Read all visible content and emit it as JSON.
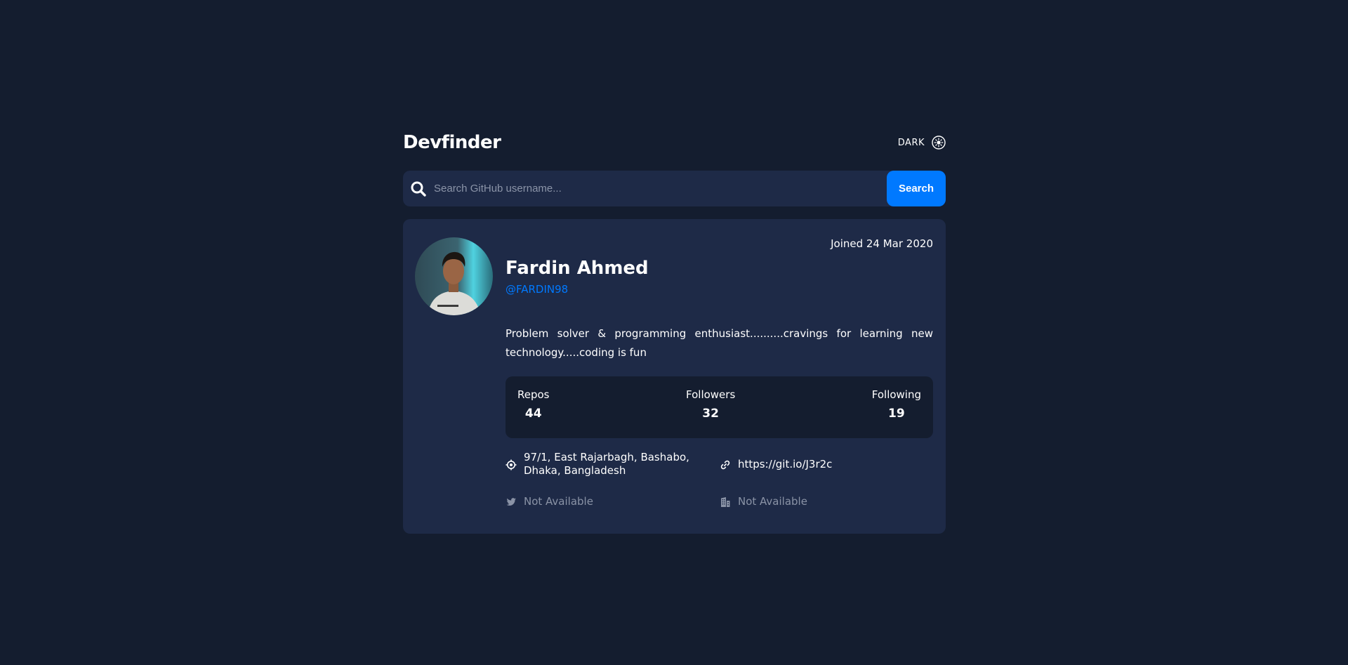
{
  "header": {
    "logo": "Devfinder",
    "theme_label": "DARK",
    "theme_icon": "sun-icon"
  },
  "search": {
    "placeholder": "Search GitHub username...",
    "value": "",
    "button_label": "Search",
    "icon": "search-icon"
  },
  "profile": {
    "joined": "Joined 24 Mar 2020",
    "name": "Fardin Ahmed",
    "login": "@FARDIN98",
    "bio": "Problem solver & programming enthusiast..........cravings for learning new technology.....coding is fun",
    "stats": {
      "repos_label": "Repos",
      "repos_value": "44",
      "followers_label": "Followers",
      "followers_value": "32",
      "following_label": "Following",
      "following_value": "19"
    },
    "location": "97/1, East Rajarbagh, Bashabo, Dhaka, Bangladesh",
    "blog": "https://git.io/J3r2c",
    "twitter": "Not Available",
    "company": "Not Available"
  },
  "colors": {
    "background": "#141d2f",
    "card": "#1e2a47",
    "accent": "#0079ff",
    "muted": "#8a93a6"
  }
}
